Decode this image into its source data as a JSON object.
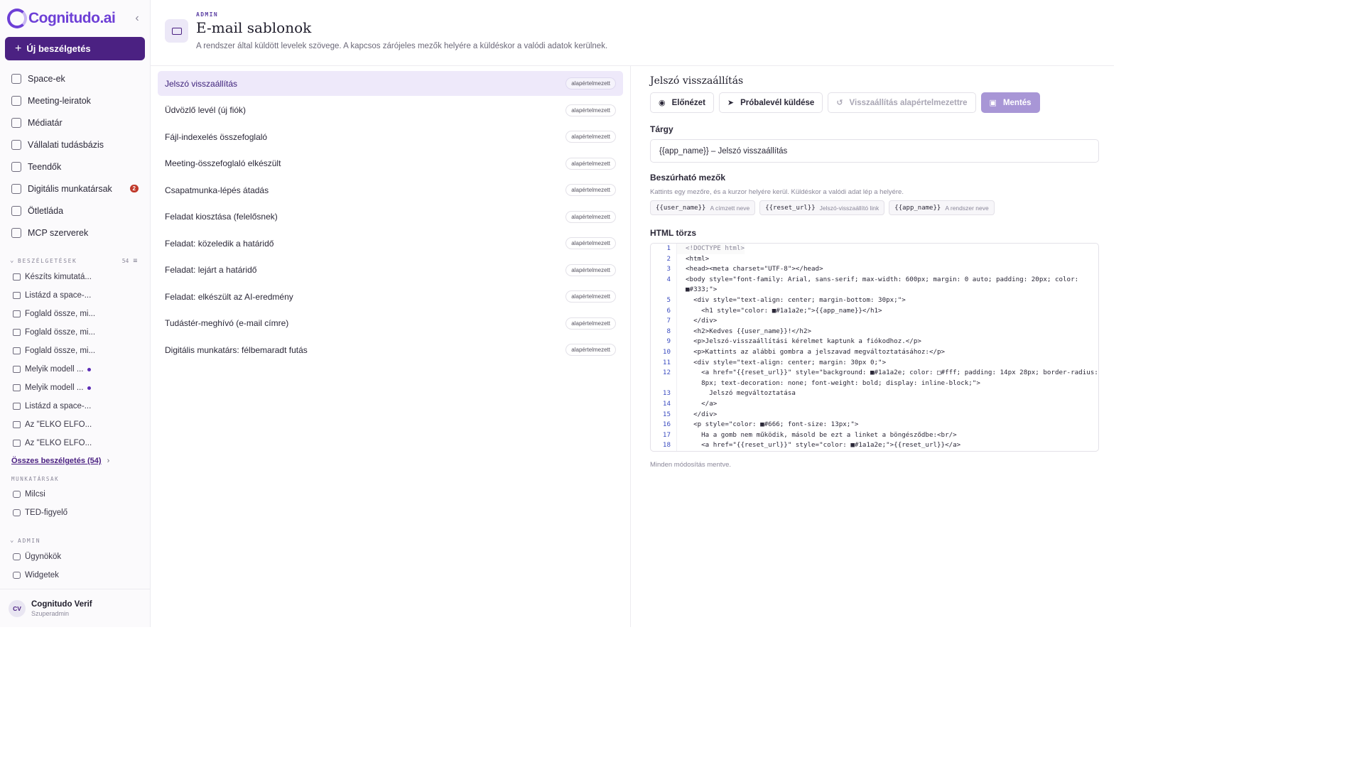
{
  "sidebar": {
    "brand": "Cognitudo.ai",
    "new_chat": "Új beszélgetés",
    "nav": [
      {
        "label": "Space-ek",
        "icon": "folder-icon"
      },
      {
        "label": "Meeting-leiratok",
        "icon": "video-icon"
      },
      {
        "label": "Médiatár",
        "icon": "image-icon"
      },
      {
        "label": "Vállalati tudásbázis",
        "icon": "graduation-icon"
      },
      {
        "label": "Teendők",
        "icon": "checklist-icon"
      },
      {
        "label": "Digitális munkatársak",
        "icon": "bot-icon",
        "badge": "2"
      },
      {
        "label": "Ötletláda",
        "icon": "lightbulb-icon"
      },
      {
        "label": "MCP szerverek",
        "icon": "plug-icon"
      }
    ],
    "conversations_header": "BESZÉLGETÉSEK",
    "conversations_count": "54",
    "conversations": [
      {
        "title": "Készíts kimutatá...",
        "unread": false
      },
      {
        "title": "Listázd a space-...",
        "unread": false
      },
      {
        "title": "Foglald össze, mi...",
        "unread": false
      },
      {
        "title": "Foglald össze, mi...",
        "unread": false
      },
      {
        "title": "Foglald össze, mi...",
        "unread": false
      },
      {
        "title": "Melyik modell ...",
        "unread": true
      },
      {
        "title": "Melyik modell ...",
        "unread": true
      },
      {
        "title": "Listázd a space-...",
        "unread": false
      },
      {
        "title": "Az \"ELKO ELFO...",
        "unread": false
      },
      {
        "title": "Az \"ELKO ELFO...",
        "unread": false
      }
    ],
    "all_conversations": "Összes beszélgetés (54)",
    "workers_header": "MUNKATÁRSAK",
    "workers": [
      "Milcsi",
      "TED-figyelő"
    ],
    "admin_header": "ADMIN",
    "admin_items": [
      "Ügynökök",
      "Widgetek"
    ],
    "user": {
      "initials": "CV",
      "name": "Cognitudo Verif",
      "role": "Szuperadmin"
    }
  },
  "header": {
    "eyebrow": "ADMIN",
    "title": "E-mail sablonok",
    "description": "A rendszer által küldött levelek szövege. A kapcsos zárójeles mezők helyére a küldéskor a valódi adatok kerülnek."
  },
  "templates": [
    {
      "name": "Jelszó visszaállítás",
      "badge": "alapértelmezett",
      "selected": true
    },
    {
      "name": "Üdvözlő levél (új fiók)",
      "badge": "alapértelmezett"
    },
    {
      "name": "Fájl-indexelés összefoglaló",
      "badge": "alapértelmezett"
    },
    {
      "name": "Meeting-összefoglaló elkészült",
      "badge": "alapértelmezett"
    },
    {
      "name": "Csapatmunka-lépés átadás",
      "badge": "alapértelmezett"
    },
    {
      "name": "Feladat kiosztása (felelősnek)",
      "badge": "alapértelmezett"
    },
    {
      "name": "Feladat: közeledik a határidő",
      "badge": "alapértelmezett"
    },
    {
      "name": "Feladat: lejárt a határidő",
      "badge": "alapértelmezett"
    },
    {
      "name": "Feladat: elkészült az AI-eredmény",
      "badge": "alapértelmezett"
    },
    {
      "name": "Tudástér-meghívó (e-mail címre)",
      "badge": "alapértelmezett"
    },
    {
      "name": "Digitális munkatárs: félbemaradt futás",
      "badge": "alapértelmezett"
    }
  ],
  "editor": {
    "title": "Jelszó visszaállítás",
    "preview": "Előnézet",
    "send_test": "Próbalevél küldése",
    "reset": "Visszaállítás alapértelmezettre",
    "save": "Mentés",
    "subject_label": "Tárgy",
    "subject_value": "{{app_name}} – Jelszó visszaállítás",
    "fields_label": "Beszúrható mezők",
    "fields_hint": "Kattints egy mezőre, és a kurzor helyére kerül. Küldéskor a valódi adat lép a helyére.",
    "fields": [
      {
        "code": "{{user_name}}",
        "desc": "A címzett neve"
      },
      {
        "code": "{{reset_url}}",
        "desc": "Jelszó-visszaállító link"
      },
      {
        "code": "{{app_name}}",
        "desc": "A rendszer neve"
      }
    ],
    "html_label": "HTML törzs",
    "code_lines": [
      {
        "n": "1",
        "t": "<!DOCTYPE html>"
      },
      {
        "n": "2",
        "t": "<html>"
      },
      {
        "n": "3",
        "t": "<head><meta charset=\"UTF-8\"></head>"
      },
      {
        "n": "4",
        "t": "<body style=\"font-family: Arial, sans-serif; max-width: 600px; margin: 0 auto; padding: 20px; color:"
      },
      {
        "n": "",
        "t": "■#333;\">"
      },
      {
        "n": "5",
        "t": "  <div style=\"text-align: center; margin-bottom: 30px;\">"
      },
      {
        "n": "6",
        "t": "    <h1 style=\"color: ■#1a1a2e;\">{{app_name}}</h1>"
      },
      {
        "n": "7",
        "t": "  </div>"
      },
      {
        "n": "8",
        "t": "  <h2>Kedves {{user_name}}!</h2>"
      },
      {
        "n": "9",
        "t": "  <p>Jelszó-visszaállítási kérelmet kaptunk a fiókodhoz.</p>"
      },
      {
        "n": "10",
        "t": "  <p>Kattints az alábbi gombra a jelszavad megváltoztatásához:</p>"
      },
      {
        "n": "11",
        "t": "  <div style=\"text-align: center; margin: 30px 0;\">"
      },
      {
        "n": "12",
        "t": "    <a href=\"{{reset_url}}\" style=\"background: ■#1a1a2e; color: □#fff; padding: 14px 28px; border-radius:"
      },
      {
        "n": "",
        "t": "    8px; text-decoration: none; font-weight: bold; display: inline-block;\">"
      },
      {
        "n": "13",
        "t": "      Jelszó megváltoztatása"
      },
      {
        "n": "14",
        "t": "    </a>"
      },
      {
        "n": "15",
        "t": "  </div>"
      },
      {
        "n": "16",
        "t": "  <p style=\"color: ■#666; font-size: 13px;\">"
      },
      {
        "n": "17",
        "t": "    Ha a gomb nem működik, másold be ezt a linket a böngésződbe:<br/>"
      },
      {
        "n": "18",
        "t": "    <a href=\"{{reset_url}}\" style=\"color: ■#1a1a2e;\">{{reset_url}}</a>"
      }
    ],
    "status": "Minden módosítás mentve."
  },
  "colors": {
    "accent": "#4b2182",
    "brand": "#6d3fd6",
    "selected_row": "#eee9fa",
    "save_button": "#a896d6",
    "badge_red": "#c0392b"
  }
}
